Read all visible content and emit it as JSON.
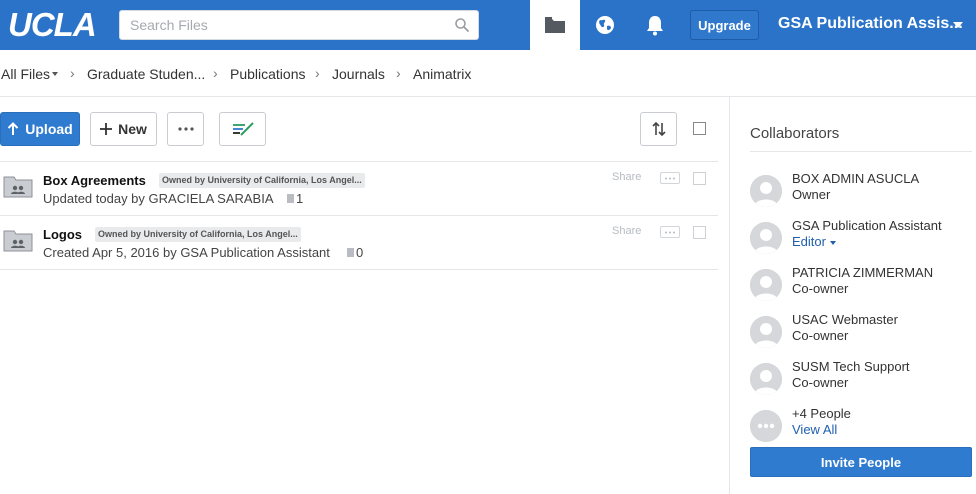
{
  "header": {
    "logo": "UCLA",
    "search_placeholder": "Search Files",
    "upgrade_label": "Upgrade",
    "account_name": "GSA Publication Assis...",
    "brand_color": "#2a73c8",
    "icons": [
      "folder-icon",
      "globe-icon",
      "bell-icon"
    ]
  },
  "breadcrumb": [
    "All Files",
    "Graduate Studen...",
    "Publications",
    "Journals",
    "Animatrix"
  ],
  "toolbar": {
    "upload_label": "Upload",
    "new_label": "New"
  },
  "files": [
    {
      "name": "Box Agreements",
      "owner": "Owned by University of California, Los Angel...",
      "meta": "Updated today by GRACIELA SARABIA",
      "count": "1",
      "share": "Share"
    },
    {
      "name": "Logos",
      "owner": "Owned by University of California, Los Angel...",
      "meta": "Created Apr 5, 2016 by GSA Publication Assistant",
      "count": "0",
      "share": "Share"
    }
  ],
  "sidebar": {
    "title": "Collaborators",
    "collaborators": [
      {
        "name": "BOX ADMIN ASUCLA",
        "role": "Owner"
      },
      {
        "name": "GSA Publication Assistant",
        "role": "Editor"
      },
      {
        "name": "PATRICIA ZIMMERMAN",
        "role": "Co-owner"
      },
      {
        "name": "USAC Webmaster",
        "role": "Co-owner"
      },
      {
        "name": "SUSM Tech Support",
        "role": "Co-owner"
      }
    ],
    "more_people": "+4 People",
    "view_all": "View All",
    "invite_label": "Invite People"
  }
}
